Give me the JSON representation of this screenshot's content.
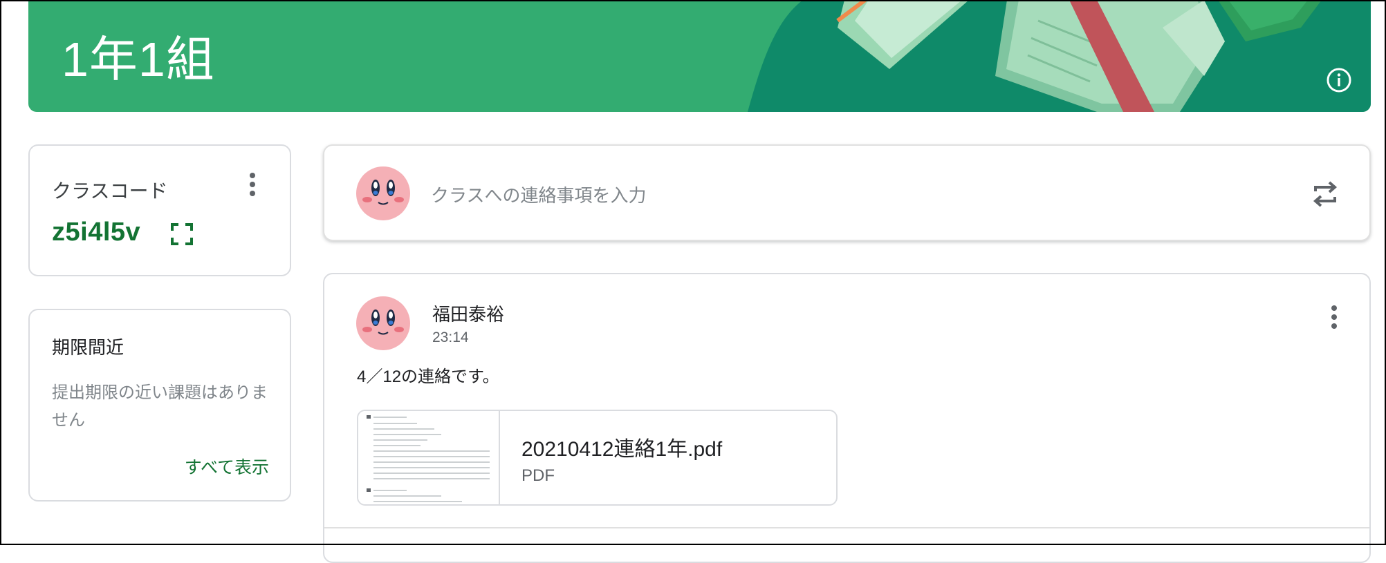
{
  "class": {
    "title": "1年1組"
  },
  "colors": {
    "banner": "#33ac71",
    "banner_dark": "#0d8a6a",
    "accent_text": "#137333"
  },
  "class_code": {
    "label": "クラスコード",
    "code": "z5i4l5v",
    "menu_icon": "more-vert-icon",
    "fullscreen_icon": "fullscreen-icon"
  },
  "upcoming": {
    "title": "期限間近",
    "empty_text": "提出期限の近い課題はありません",
    "view_all": "すべて表示"
  },
  "announce": {
    "placeholder": "クラスへの連絡事項を入力",
    "repost_icon": "repost-icon"
  },
  "post": {
    "author": "福田泰裕",
    "time": "23:14",
    "text": "4／12の連絡です。",
    "attachment": {
      "name": "20210412連絡1年.pdf",
      "type": "PDF"
    }
  }
}
